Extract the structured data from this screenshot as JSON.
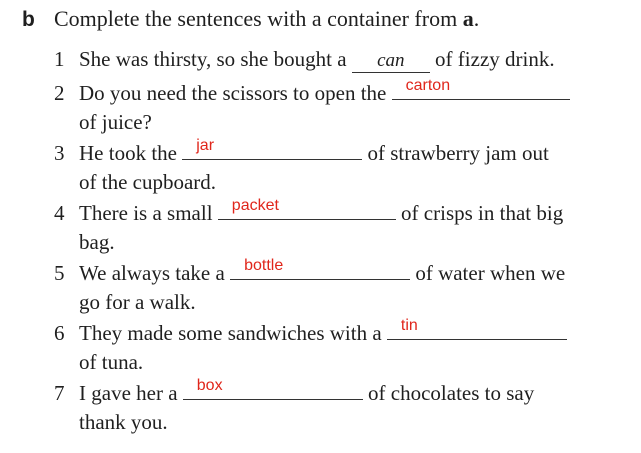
{
  "exercise": {
    "letter": "b",
    "instruction_pre": "Complete the sentences with a container from",
    "instruction_ref": "a",
    "instruction_post": "."
  },
  "items": [
    {
      "num": "1",
      "before": "She was thirsty, so she bought a",
      "answer": "can",
      "after": "of fizzy drink.",
      "cont": ""
    },
    {
      "num": "2",
      "before": "Do you need the scissors to open the",
      "answer": "carton",
      "after": "",
      "cont": "of juice?"
    },
    {
      "num": "3",
      "before": "He took the",
      "answer": "jar",
      "after": "of strawberry jam out",
      "cont": "of the cupboard."
    },
    {
      "num": "4",
      "before": "There is a small",
      "answer": "packet",
      "after": "of crisps in that big",
      "cont": "bag."
    },
    {
      "num": "5",
      "before": "We always take a",
      "answer": "bottle",
      "after": "of water when we",
      "cont": "go for a walk."
    },
    {
      "num": "6",
      "before": "They made some sandwiches with a",
      "answer": "tin",
      "after": "",
      "cont": "of tuna."
    },
    {
      "num": "7",
      "before": "I gave her a",
      "answer": "box",
      "after": "of chocolates to say",
      "cont": "thank you."
    }
  ]
}
